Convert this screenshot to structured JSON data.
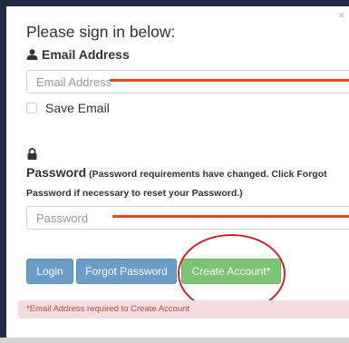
{
  "dialog": {
    "heading": "Please sign in below:",
    "close_glyph": "×"
  },
  "email": {
    "label": "Email Address",
    "placeholder": "Email Address",
    "value": "",
    "icon": "user-icon"
  },
  "save_email": {
    "label": "Save Email",
    "checked": false
  },
  "password": {
    "icon": "lock-icon",
    "label_main": "Password",
    "label_note": "(Password requirements have changed. Click Forgot Password if necessary to reset your Password.)",
    "placeholder": "Password",
    "value": ""
  },
  "buttons": {
    "login": "Login",
    "forgot": "Forgot Password",
    "create": "Create Account*"
  },
  "alert": {
    "text": "*Email Address required to Create Account"
  },
  "colors": {
    "primary_button": "#6a9dc7",
    "success_button": "#7cc472",
    "annotation": "#c8262e",
    "annotation_line": "#e8461e",
    "alert_bg": "#f2dede",
    "alert_text": "#d04545"
  }
}
